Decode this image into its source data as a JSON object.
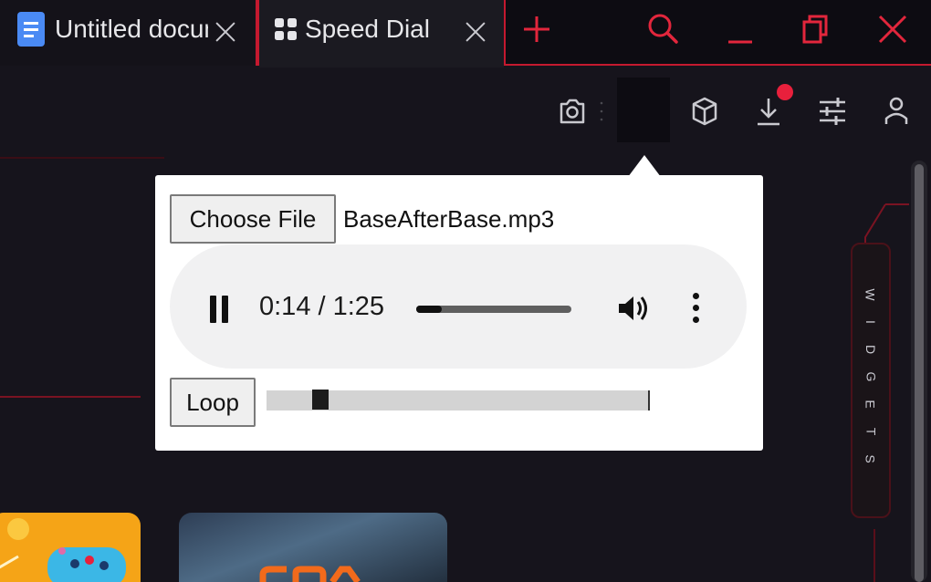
{
  "tabs": [
    {
      "title": "Untitled document",
      "icon": "docs-icon",
      "active": false
    },
    {
      "title": "Speed Dial",
      "icon": "speed-dial-icon",
      "active": true
    }
  ],
  "window_controls": [
    "new-tab-icon",
    "search-icon",
    "minimize-icon",
    "restore-icon",
    "close-icon"
  ],
  "toolbar": {
    "icons": [
      "camera-icon",
      "extension-icon",
      "cube-icon",
      "download-icon",
      "settings-sliders-icon",
      "profile-icon"
    ],
    "download_badge": true
  },
  "popup": {
    "choose_file_label": "Choose File",
    "file_name": "BaseAfterBase.mp3",
    "audio": {
      "state": "playing",
      "time": "0:14 / 1:25",
      "progress": 0.165
    },
    "loop_label": "Loop",
    "loop_slider_value": 0.14
  },
  "sidebar": {
    "widgets_label": "WIDGETS"
  },
  "colors": {
    "accent": "#c4192f",
    "background": "#16141c",
    "tabbar": "#0d0c12",
    "badge": "#e8203c",
    "tile_orange": "#f5a417"
  }
}
